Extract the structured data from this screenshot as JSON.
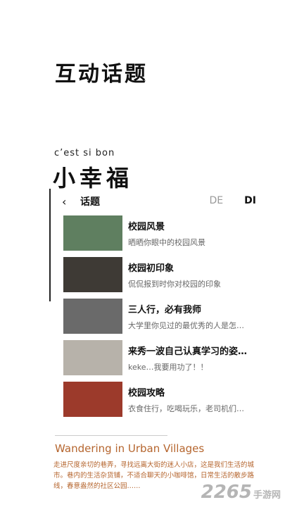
{
  "page": {
    "title": "互动话题"
  },
  "brand": {
    "eyebrow": "c’est si    bon",
    "title": "小幸福"
  },
  "phone": {
    "nav": {
      "back_icon": "‹",
      "title": "话题",
      "tabs": [
        "DE",
        "DI"
      ]
    },
    "items": [
      {
        "title": "校园风景",
        "subtitle": "晒晒你眼中的校园风景",
        "thumb_color": "#5f7f60"
      },
      {
        "title": "校园初印象",
        "subtitle": "侃侃报到时你对校园的印象",
        "thumb_color": "#3e3a35"
      },
      {
        "title": "三人行，必有我师",
        "subtitle": "大学里你见过的最优秀的人是怎…",
        "thumb_color": "#6a6a6a"
      },
      {
        "title": "来秀一波自己认真学习的姿…",
        "subtitle": "keke…我要用功了！！",
        "thumb_color": "#b7b2aa"
      },
      {
        "title": "校园攻略",
        "subtitle": "衣食住行，吃喝玩乐，老司机们…",
        "thumb_color": "#9c3a2b"
      }
    ]
  },
  "footer": {
    "title": "Wandering in Urban Villages",
    "body": "走进尺度亲切的巷弄，寻找远离大街的迷人小店，这是我们生活的城市。巷内的生活杂货铺，不适合聊天的小咖啡馆，日常生活的散步路线，春意盎然的社区公园……"
  },
  "watermark": {
    "brand": "2265",
    "site": "手游网"
  }
}
